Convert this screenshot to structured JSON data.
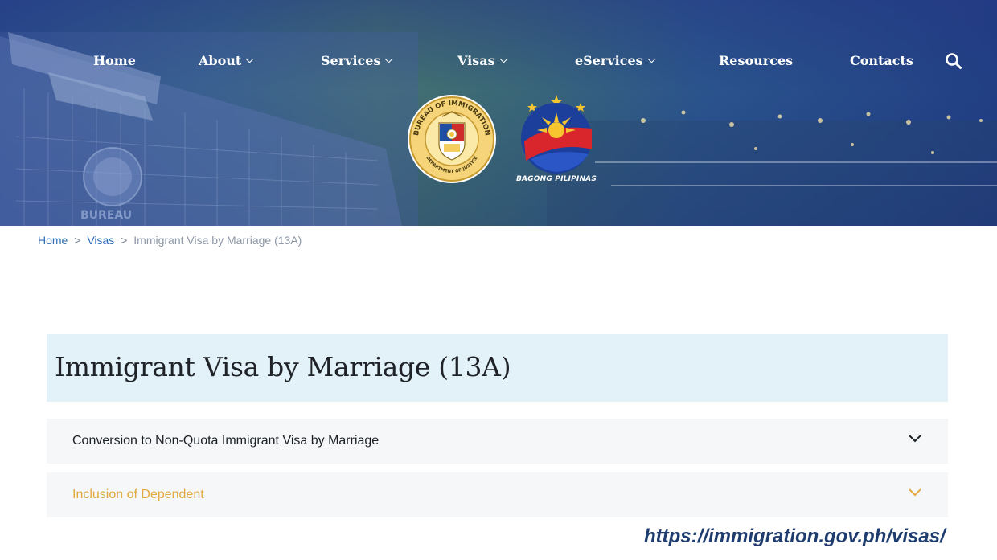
{
  "nav": {
    "items": [
      {
        "label": "Home"
      },
      {
        "label": "About"
      },
      {
        "label": "Services"
      },
      {
        "label": "Visas"
      },
      {
        "label": "eServices"
      },
      {
        "label": "Resources"
      },
      {
        "label": "Contacts"
      }
    ],
    "search_icon": "search-icon"
  },
  "hero": {
    "seal_text_top": "BUREAU OF IMMIGRATION",
    "seal_text_bottom": "DEPARTMENT OF JUSTICE",
    "building_sign": "BUREAU",
    "brand_text": "BAGONG PILIPINAS"
  },
  "breadcrumb": {
    "home": "Home",
    "separator": ">",
    "visas": "Visas",
    "current": "Immigrant Visa by Marriage (13A)"
  },
  "page": {
    "title": "Immigrant Visa by Marriage (13A)"
  },
  "accordion": [
    {
      "label": "Conversion to Non-Quota Immigrant Visa by Marriage",
      "color": "#1c1f23"
    },
    {
      "label": "Inclusion of Dependent",
      "color": "#e3a93e"
    }
  ],
  "caption": {
    "url": "https://immigration.gov.ph/visas/"
  },
  "colors": {
    "link": "#2f6db5",
    "title_bg": "#e3f1f9",
    "accent_orange": "#e3a93e",
    "url_caption": "#1f3c6e"
  }
}
